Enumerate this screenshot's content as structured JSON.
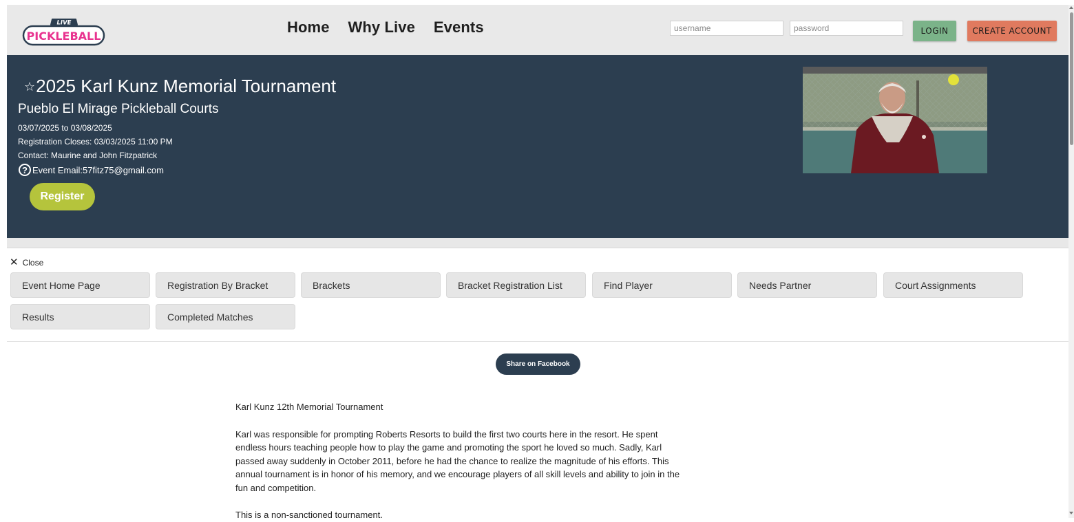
{
  "header": {
    "logo": {
      "top_text": "LIVE",
      "bottom_text": "PICKLEBALL"
    },
    "nav": [
      "Home",
      "Why Live",
      "Events"
    ],
    "username_placeholder": "username",
    "password_placeholder": "password",
    "login_label": "LOGIN",
    "create_account_label": "CREATE ACCOUNT"
  },
  "event": {
    "star": "☆",
    "title": "2025 Karl Kunz Memorial Tournament",
    "venue": "Pueblo El Mirage Pickleball Courts",
    "dates": "03/07/2025 to 03/08/2025",
    "registration_closes": "Registration Closes: 03/03/2025 11:00 PM",
    "contact": "Contact: Maurine and John Fitzpatrick",
    "email": "Event Email:57fitz75@gmail.com",
    "register_label": "Register"
  },
  "menu": {
    "close_label": "Close",
    "items": [
      "Event Home Page",
      "Registration By Bracket",
      "Brackets",
      "Bracket Registration List",
      "Find Player",
      "Needs Partner",
      "Court Assignments",
      "Results",
      "Completed Matches"
    ]
  },
  "share_label": "Share on Facebook",
  "content": {
    "heading": "Karl Kunz 12th Memorial Tournament",
    "paragraph": "Karl was responsible for prompting Roberts Resorts to build the first two courts here in the resort. He spent endless hours teaching people how to play the game and promoting the sport he loved so much. Sadly, Karl passed away suddenly in October 2011, before he had the chance to realize the magnitude of his efforts. This annual tournament is in honor of his memory, and we encourage players of all skill levels and ability to join in the fun and competition.",
    "note": "This is a non-sanctioned tournament."
  },
  "colors": {
    "hero_bg": "#2c3e50",
    "login_btn": "#7bb389",
    "create_btn": "#e07a5f",
    "register_btn": "#b5c43c",
    "logo_pink": "#e8338f"
  }
}
